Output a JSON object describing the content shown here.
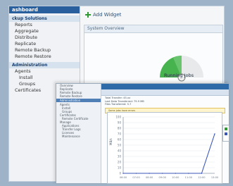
{
  "back": {
    "sidebar": {
      "header": "ashboard",
      "section1": "ckup Solutions",
      "items": [
        "Reports",
        "Aggregate",
        "Distribute",
        "Replicate",
        "Remote Backup",
        "Remote Restore"
      ],
      "section2": "Administration",
      "admin_items": [
        "Agents",
        "Install",
        "Groups",
        "Certificates"
      ]
    },
    "add_widget": "Add Widget",
    "widget_title": "System Overview",
    "gauge_label": "Running Jobs"
  },
  "front": {
    "sidebar_items": [
      "Overview",
      "Replicate",
      "Remote Backup",
      "Remote Restore"
    ],
    "section": "Administration",
    "admin_items": [
      "Agents",
      "Install",
      "Groups",
      "Certificates",
      "Remote Certificate",
      "Manage",
      "Applications",
      "Transfer Logs",
      "Licenses",
      "Maintenance"
    ],
    "info_lines": [
      "Total Transfer: 45.xx",
      "Last Data Transferred: 79.9 MB",
      "Files Transferred: 5.7"
    ],
    "warning": "Some jobs have errors"
  },
  "chart_data": {
    "type": "line",
    "x": [
      "06:00",
      "07:00",
      "08:00",
      "09:00",
      "10:00",
      "11:00",
      "12:00",
      "13:00"
    ],
    "series": [
      {
        "values": [
          0,
          0,
          0,
          0,
          0,
          0,
          0,
          70
        ]
      }
    ],
    "ylim": [
      0,
      100
    ],
    "yticks": [
      "100",
      "90",
      "80",
      "70",
      "60",
      "50",
      "40",
      "30",
      "20",
      "10",
      "0"
    ],
    "ylabel": "MB/s",
    "xlabel": "",
    "grid": true,
    "legend": "right"
  },
  "colors": {
    "accent": "#2a5f9e",
    "line": "#3a57b7",
    "green": "#2f9a32"
  },
  "icons": [
    "add-icon",
    "gauge-icon"
  ]
}
